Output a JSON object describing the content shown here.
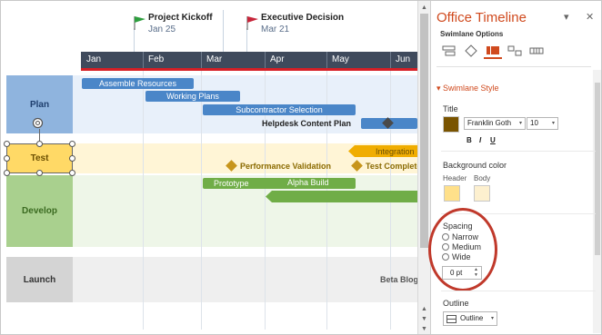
{
  "milestones": [
    {
      "label": "Project Kickoff",
      "date": "Jan 25",
      "color": "#2e9e3e"
    },
    {
      "label": "Executive Decision",
      "date": "Mar 21",
      "color": "#c7253a"
    }
  ],
  "months": [
    "Jan",
    "Feb",
    "Mar",
    "Apr",
    "May",
    "Jun"
  ],
  "swimlanes": {
    "plan": {
      "label": "Plan",
      "header_color": "#8fb4de",
      "body_color": "#e8f0fa",
      "text_color": "#1f3f6e"
    },
    "test": {
      "label": "Test",
      "header_color": "#ffd966",
      "body_color": "#fff5d6",
      "text_color": "#6b4f00"
    },
    "develop": {
      "label": "Develop",
      "header_color": "#a9d08e",
      "body_color": "#eef6e8",
      "text_color": "#3a6a20"
    },
    "launch": {
      "label": "Launch",
      "header_color": "#d4d4d4",
      "body_color": "#efefef",
      "text_color": "#333333"
    }
  },
  "tasks": {
    "assemble": "Assemble Resources",
    "working": "Working Plans",
    "subcontractor": "Subcontractor Selection",
    "helpdesk": "Helpdesk Content Plan",
    "integration": "Integration",
    "performance": "Performance Validation",
    "test_complete": "Test Complete",
    "prototype": "Prototype",
    "alpha": "Alpha Build",
    "beta_blog": "Beta Blog"
  },
  "panel": {
    "title": "Office Timeline",
    "pin": "▾",
    "close": "✕",
    "subtitle": "Swimlane Options",
    "section": "Swimlane Style",
    "title_label": "Title",
    "font": "Franklin Goth",
    "size": "10",
    "bold": "B",
    "italic": "I",
    "underline": "U",
    "title_color": "#7a5400",
    "bg_label": "Background color",
    "header_label": "Header",
    "body_label": "Body",
    "header_swatch": "#ffe08a",
    "body_swatch": "#fdf0cf",
    "spacing_label": "Spacing",
    "spacing_options": [
      "Narrow",
      "Medium",
      "Wide"
    ],
    "spacing_value": "0 pt",
    "outline_label": "Outline",
    "outline_value": "Outline",
    "accent": "#d04a1e"
  }
}
